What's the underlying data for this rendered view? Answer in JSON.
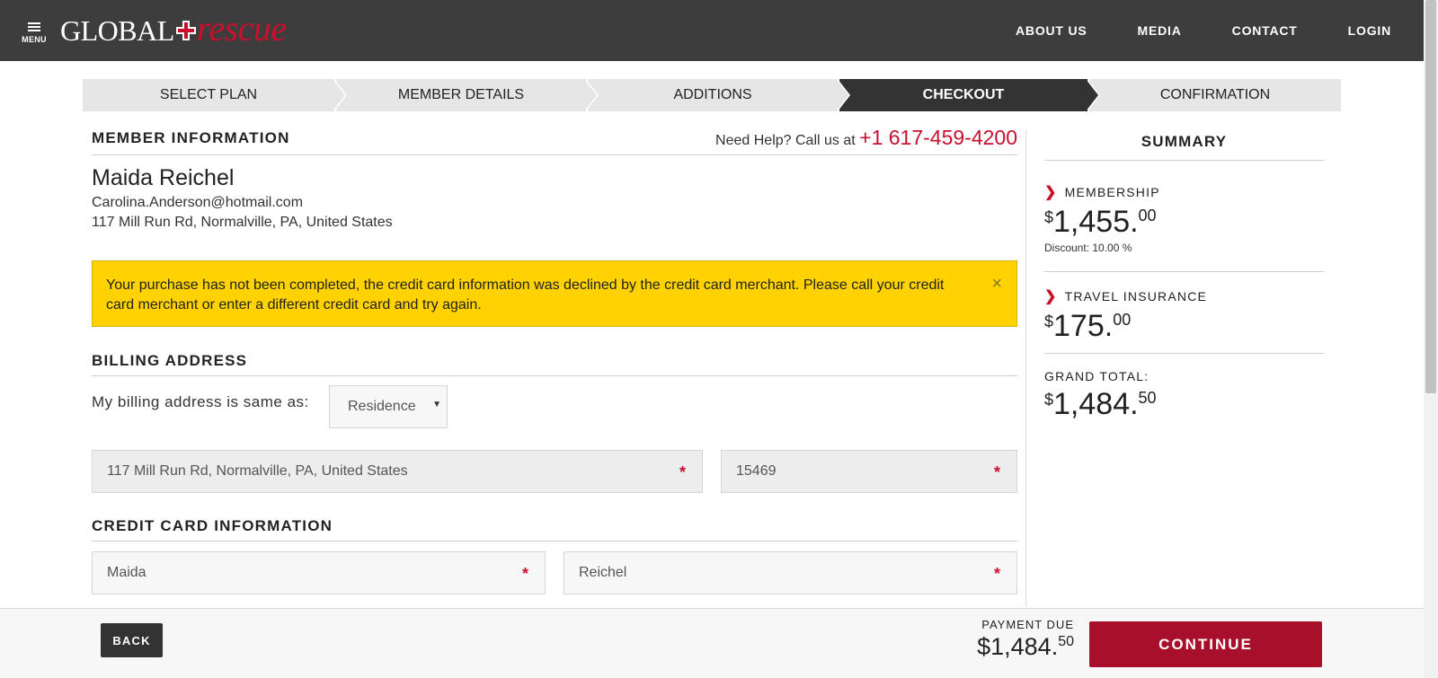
{
  "header": {
    "menu_label": "MENU",
    "logo_primary": "GLOBAL",
    "logo_secondary": "rescue",
    "nav": [
      "ABOUT US",
      "MEDIA",
      "CONTACT",
      "LOGIN"
    ]
  },
  "steps": {
    "items": [
      "SELECT PLAN",
      "MEMBER DETAILS",
      "ADDITIONS",
      "CHECKOUT",
      "CONFIRMATION"
    ],
    "active": "CHECKOUT"
  },
  "member": {
    "section_title": "MEMBER INFORMATION",
    "help_text": "Need Help? Call us at",
    "help_phone": "+1 617-459-4200",
    "name": "Maida Reichel",
    "email": "Carolina.Anderson@hotmail.com",
    "address": "117 Mill Run Rd, Normalville, PA, United States"
  },
  "alert": {
    "message": "Your purchase has not been completed, the credit card information was declined by the credit card merchant. Please call your credit card merchant or enter a different credit card and try again.",
    "close_glyph": "×"
  },
  "billing": {
    "section_title": "BILLING ADDRESS",
    "same_as_label": "My billing address is same as:",
    "same_as_value": "Residence",
    "address_value": "117 Mill Run Rd, Normalville, PA, United States",
    "zip_value": "15469",
    "required_glyph": "*"
  },
  "credit_card": {
    "section_title": "CREDIT CARD INFORMATION",
    "first_name_value": "Maida",
    "last_name_value": "Reichel"
  },
  "summary": {
    "title": "SUMMARY",
    "membership": {
      "label": "MEMBERSHIP",
      "currency": "$",
      "whole": "1,455.",
      "cents": "00",
      "discount": "Discount: 10.00 %"
    },
    "travel_insurance": {
      "label": "TRAVEL INSURANCE",
      "currency": "$",
      "whole": "175.",
      "cents": "00"
    },
    "grand_total": {
      "label": "GRAND TOTAL:",
      "currency": "$",
      "whole": "1,484.",
      "cents": "50"
    }
  },
  "footer": {
    "back_label": "BACK",
    "payment_due_label": "PAYMENT DUE",
    "payment_due_whole": "$1,484.",
    "payment_due_cents": "50",
    "continue_label": "CONTINUE"
  },
  "colors": {
    "header_bg": "#3d3d3d",
    "brand_red": "#c8102e",
    "alert_yellow": "#ffd200",
    "continue_red": "#a80f2a",
    "active_step": "#333333"
  }
}
